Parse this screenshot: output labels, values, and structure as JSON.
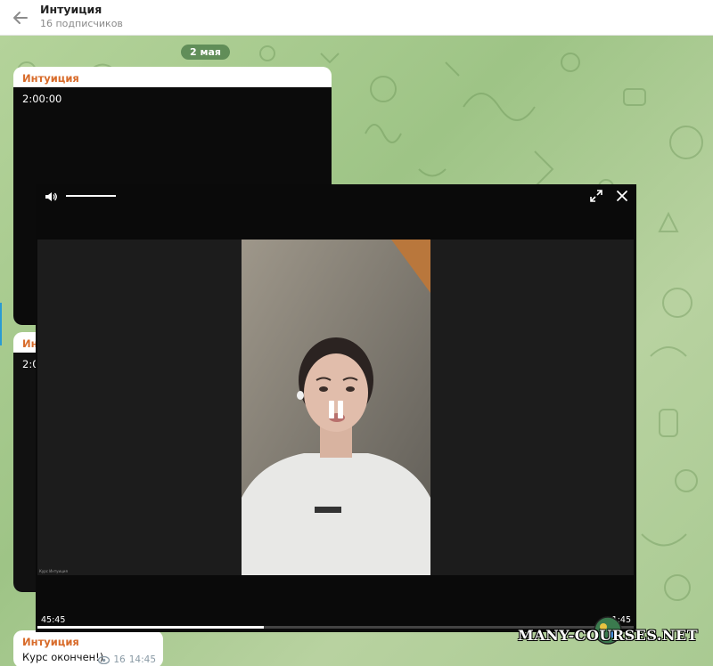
{
  "header": {
    "title": "Интуиция",
    "subtitle": "16 подписчиков"
  },
  "chat": {
    "date_label": "2 мая",
    "messages": [
      {
        "sender": "Интуиция",
        "duration": "2:00:00"
      },
      {
        "sender": "Инт",
        "duration": "2:0"
      },
      {
        "sender": "Интуиция",
        "text": "Курс окончен!)",
        "views": "16",
        "time": "14:45"
      }
    ]
  },
  "player": {
    "current_time": "45:45",
    "total_time": "1:45",
    "progress": 0.38,
    "volume": 1.0,
    "video_caption": "Курс Интуиция"
  },
  "watermark": {
    "text": "MANY-COURSES.NET"
  },
  "colors": {
    "sender": "#d86b2a",
    "chat_bg": "#a8c98c",
    "player_bg": "#0a0a0a"
  }
}
